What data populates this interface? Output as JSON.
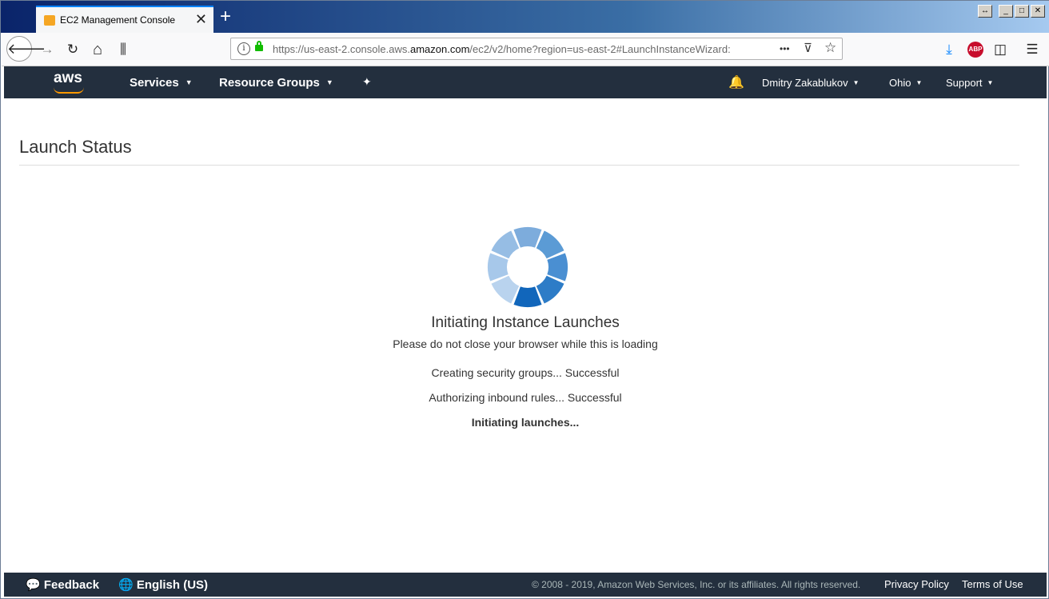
{
  "browser": {
    "tab_title": "EC2 Management Console",
    "tab_close": "✕",
    "new_tab": "+",
    "url_prefix": "https://us-east-2.console.aws.",
    "url_domain": "amazon.com",
    "url_suffix": "/ec2/v2/home?region=us-east-2#LaunchInstanceWizard:",
    "icons": {
      "back": "🡐",
      "forward": "→",
      "reload": "↻",
      "home": "⌂",
      "library": "⫼",
      "more": "•••",
      "pocket": "⊽",
      "bookmark": "☆",
      "download": "⤓",
      "abp": "ABP",
      "sidebar": "◫",
      "menu": "☰",
      "resize": "↔",
      "minimize": "_",
      "maximize": "□",
      "close": "✕"
    }
  },
  "aws_nav": {
    "logo": "aws",
    "services": "Services",
    "resource_groups": "Resource Groups",
    "pin": "✦",
    "bell": "🔔",
    "user": "Dmitry Zakablukov",
    "region": "Ohio",
    "support": "Support",
    "caret": "▼"
  },
  "page": {
    "title": "Launch Status",
    "status_title": "Initiating Instance Launches",
    "status_sub": "Please do not close your browser while this is loading",
    "steps": [
      "Creating security groups... Successful",
      "Authorizing inbound rules... Successful",
      "Initiating launches..."
    ]
  },
  "spinner_colors": [
    "#1166bb",
    "#2d7cc7",
    "#4a8fd2",
    "#5b9bd5",
    "#7dacdc",
    "#96bde4",
    "#a7c8ea",
    "#b9d3ee"
  ],
  "footer": {
    "feedback_icon": "💬",
    "feedback": "Feedback",
    "language_icon": "🌐",
    "language": "English (US)",
    "copyright": "© 2008 - 2019, Amazon Web Services, Inc. or its affiliates. All rights reserved.",
    "privacy": "Privacy Policy",
    "terms": "Terms of Use"
  }
}
